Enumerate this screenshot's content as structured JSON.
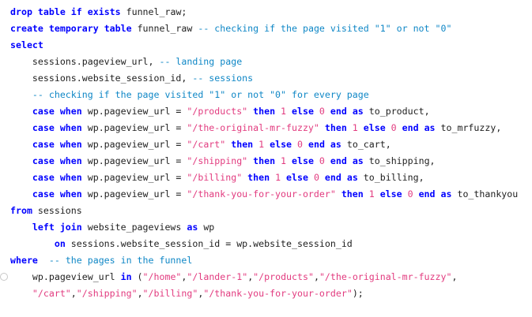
{
  "editor": {
    "lines": [
      {
        "tokens": [
          {
            "t": "kw",
            "v": "drop"
          },
          {
            "t": "pn",
            "v": " "
          },
          {
            "t": "kw",
            "v": "table"
          },
          {
            "t": "pn",
            "v": " "
          },
          {
            "t": "kw",
            "v": "if"
          },
          {
            "t": "pn",
            "v": " "
          },
          {
            "t": "kw",
            "v": "exists"
          },
          {
            "t": "pn",
            "v": " funnel_raw;"
          }
        ]
      },
      {
        "tokens": [
          {
            "t": "kw",
            "v": "create"
          },
          {
            "t": "pn",
            "v": " "
          },
          {
            "t": "kw",
            "v": "temporary"
          },
          {
            "t": "pn",
            "v": " "
          },
          {
            "t": "kw",
            "v": "table"
          },
          {
            "t": "pn",
            "v": " funnel_raw "
          },
          {
            "t": "cm",
            "v": "-- checking if the page visited \"1\" or not \"0\""
          }
        ]
      },
      {
        "tokens": [
          {
            "t": "kw",
            "v": "select"
          }
        ]
      },
      {
        "tokens": [
          {
            "t": "pn",
            "v": "    sessions.pageview_url, "
          },
          {
            "t": "cm",
            "v": "-- landing page"
          }
        ]
      },
      {
        "tokens": [
          {
            "t": "pn",
            "v": "    sessions.website_session_id, "
          },
          {
            "t": "cm",
            "v": "-- sessions"
          }
        ]
      },
      {
        "tokens": [
          {
            "t": "pn",
            "v": "    "
          },
          {
            "t": "cm",
            "v": "-- checking if the page visited \"1\" or not \"0\" for every page"
          }
        ]
      },
      {
        "tokens": [
          {
            "t": "pn",
            "v": "    "
          },
          {
            "t": "kw",
            "v": "case"
          },
          {
            "t": "pn",
            "v": " "
          },
          {
            "t": "kw",
            "v": "when"
          },
          {
            "t": "pn",
            "v": " wp.pageview_url = "
          },
          {
            "t": "st",
            "v": "\"/products\""
          },
          {
            "t": "pn",
            "v": " "
          },
          {
            "t": "kw",
            "v": "then"
          },
          {
            "t": "pn",
            "v": " "
          },
          {
            "t": "nm",
            "v": "1"
          },
          {
            "t": "pn",
            "v": " "
          },
          {
            "t": "kw",
            "v": "else"
          },
          {
            "t": "pn",
            "v": " "
          },
          {
            "t": "nm",
            "v": "0"
          },
          {
            "t": "pn",
            "v": " "
          },
          {
            "t": "kw",
            "v": "end"
          },
          {
            "t": "pn",
            "v": " "
          },
          {
            "t": "kw",
            "v": "as"
          },
          {
            "t": "pn",
            "v": " to_product,"
          }
        ]
      },
      {
        "tokens": [
          {
            "t": "pn",
            "v": "    "
          },
          {
            "t": "kw",
            "v": "case"
          },
          {
            "t": "pn",
            "v": " "
          },
          {
            "t": "kw",
            "v": "when"
          },
          {
            "t": "pn",
            "v": " wp.pageview_url = "
          },
          {
            "t": "st",
            "v": "\"/the-original-mr-fuzzy\""
          },
          {
            "t": "pn",
            "v": " "
          },
          {
            "t": "kw",
            "v": "then"
          },
          {
            "t": "pn",
            "v": " "
          },
          {
            "t": "nm",
            "v": "1"
          },
          {
            "t": "pn",
            "v": " "
          },
          {
            "t": "kw",
            "v": "else"
          },
          {
            "t": "pn",
            "v": " "
          },
          {
            "t": "nm",
            "v": "0"
          },
          {
            "t": "pn",
            "v": " "
          },
          {
            "t": "kw",
            "v": "end"
          },
          {
            "t": "pn",
            "v": " "
          },
          {
            "t": "kw",
            "v": "as"
          },
          {
            "t": "pn",
            "v": " to_mrfuzzy,"
          }
        ]
      },
      {
        "tokens": [
          {
            "t": "pn",
            "v": "    "
          },
          {
            "t": "kw",
            "v": "case"
          },
          {
            "t": "pn",
            "v": " "
          },
          {
            "t": "kw",
            "v": "when"
          },
          {
            "t": "pn",
            "v": " wp.pageview_url = "
          },
          {
            "t": "st",
            "v": "\"/cart\""
          },
          {
            "t": "pn",
            "v": " "
          },
          {
            "t": "kw",
            "v": "then"
          },
          {
            "t": "pn",
            "v": " "
          },
          {
            "t": "nm",
            "v": "1"
          },
          {
            "t": "pn",
            "v": " "
          },
          {
            "t": "kw",
            "v": "else"
          },
          {
            "t": "pn",
            "v": " "
          },
          {
            "t": "nm",
            "v": "0"
          },
          {
            "t": "pn",
            "v": " "
          },
          {
            "t": "kw",
            "v": "end"
          },
          {
            "t": "pn",
            "v": " "
          },
          {
            "t": "kw",
            "v": "as"
          },
          {
            "t": "pn",
            "v": " to_cart,"
          }
        ]
      },
      {
        "tokens": [
          {
            "t": "pn",
            "v": "    "
          },
          {
            "t": "kw",
            "v": "case"
          },
          {
            "t": "pn",
            "v": " "
          },
          {
            "t": "kw",
            "v": "when"
          },
          {
            "t": "pn",
            "v": " wp.pageview_url = "
          },
          {
            "t": "st",
            "v": "\"/shipping\""
          },
          {
            "t": "pn",
            "v": " "
          },
          {
            "t": "kw",
            "v": "then"
          },
          {
            "t": "pn",
            "v": " "
          },
          {
            "t": "nm",
            "v": "1"
          },
          {
            "t": "pn",
            "v": " "
          },
          {
            "t": "kw",
            "v": "else"
          },
          {
            "t": "pn",
            "v": " "
          },
          {
            "t": "nm",
            "v": "0"
          },
          {
            "t": "pn",
            "v": " "
          },
          {
            "t": "kw",
            "v": "end"
          },
          {
            "t": "pn",
            "v": " "
          },
          {
            "t": "kw",
            "v": "as"
          },
          {
            "t": "pn",
            "v": " to_shipping,"
          }
        ]
      },
      {
        "tokens": [
          {
            "t": "pn",
            "v": "    "
          },
          {
            "t": "kw",
            "v": "case"
          },
          {
            "t": "pn",
            "v": " "
          },
          {
            "t": "kw",
            "v": "when"
          },
          {
            "t": "pn",
            "v": " wp.pageview_url = "
          },
          {
            "t": "st",
            "v": "\"/billing\""
          },
          {
            "t": "pn",
            "v": " "
          },
          {
            "t": "kw",
            "v": "then"
          },
          {
            "t": "pn",
            "v": " "
          },
          {
            "t": "nm",
            "v": "1"
          },
          {
            "t": "pn",
            "v": " "
          },
          {
            "t": "kw",
            "v": "else"
          },
          {
            "t": "pn",
            "v": " "
          },
          {
            "t": "nm",
            "v": "0"
          },
          {
            "t": "pn",
            "v": " "
          },
          {
            "t": "kw",
            "v": "end"
          },
          {
            "t": "pn",
            "v": " "
          },
          {
            "t": "kw",
            "v": "as"
          },
          {
            "t": "pn",
            "v": " to_billing,"
          }
        ]
      },
      {
        "tokens": [
          {
            "t": "pn",
            "v": "    "
          },
          {
            "t": "kw",
            "v": "case"
          },
          {
            "t": "pn",
            "v": " "
          },
          {
            "t": "kw",
            "v": "when"
          },
          {
            "t": "pn",
            "v": " wp.pageview_url = "
          },
          {
            "t": "st",
            "v": "\"/thank-you-for-your-order\""
          },
          {
            "t": "pn",
            "v": " "
          },
          {
            "t": "kw",
            "v": "then"
          },
          {
            "t": "pn",
            "v": " "
          },
          {
            "t": "nm",
            "v": "1"
          },
          {
            "t": "pn",
            "v": " "
          },
          {
            "t": "kw",
            "v": "else"
          },
          {
            "t": "pn",
            "v": " "
          },
          {
            "t": "nm",
            "v": "0"
          },
          {
            "t": "pn",
            "v": " "
          },
          {
            "t": "kw",
            "v": "end"
          },
          {
            "t": "pn",
            "v": " "
          },
          {
            "t": "kw",
            "v": "as"
          },
          {
            "t": "pn",
            "v": " to_thankyou"
          }
        ]
      },
      {
        "tokens": [
          {
            "t": "kw",
            "v": "from"
          },
          {
            "t": "pn",
            "v": " sessions"
          }
        ]
      },
      {
        "tokens": [
          {
            "t": "pn",
            "v": "    "
          },
          {
            "t": "kw",
            "v": "left"
          },
          {
            "t": "pn",
            "v": " "
          },
          {
            "t": "kw",
            "v": "join"
          },
          {
            "t": "pn",
            "v": " website_pageviews "
          },
          {
            "t": "kw",
            "v": "as"
          },
          {
            "t": "pn",
            "v": " wp"
          }
        ]
      },
      {
        "tokens": [
          {
            "t": "pn",
            "v": "        "
          },
          {
            "t": "kw",
            "v": "on"
          },
          {
            "t": "pn",
            "v": " sessions.website_session_id = wp.website_session_id"
          }
        ]
      },
      {
        "tokens": [
          {
            "t": "kw",
            "v": "where"
          },
          {
            "t": "pn",
            "v": "  "
          },
          {
            "t": "cm",
            "v": "-- the pages in the funnel"
          }
        ]
      },
      {
        "tokens": [
          {
            "t": "pn",
            "v": "    wp.pageview_url "
          },
          {
            "t": "kw",
            "v": "in"
          },
          {
            "t": "pn",
            "v": " ("
          },
          {
            "t": "st",
            "v": "\"/home\""
          },
          {
            "t": "pn",
            "v": ","
          },
          {
            "t": "st",
            "v": "\"/lander-1\""
          },
          {
            "t": "pn",
            "v": ","
          },
          {
            "t": "st",
            "v": "\"/products\""
          },
          {
            "t": "pn",
            "v": ","
          },
          {
            "t": "st",
            "v": "\"/the-original-mr-fuzzy\""
          },
          {
            "t": "pn",
            "v": ","
          }
        ]
      },
      {
        "tokens": [
          {
            "t": "pn",
            "v": "    "
          },
          {
            "t": "st",
            "v": "\"/cart\""
          },
          {
            "t": "pn",
            "v": ","
          },
          {
            "t": "st",
            "v": "\"/shipping\""
          },
          {
            "t": "pn",
            "v": ","
          },
          {
            "t": "st",
            "v": "\"/billing\""
          },
          {
            "t": "pn",
            "v": ","
          },
          {
            "t": "st",
            "v": "\"/thank-you-for-your-order\""
          },
          {
            "t": "pn",
            "v": ");"
          }
        ]
      }
    ]
  },
  "colors": {
    "keyword": "#0000ff",
    "comment": "#0f87c6",
    "string": "#e23b7f",
    "text": "#1e1e1e",
    "background": "#ffffff"
  }
}
